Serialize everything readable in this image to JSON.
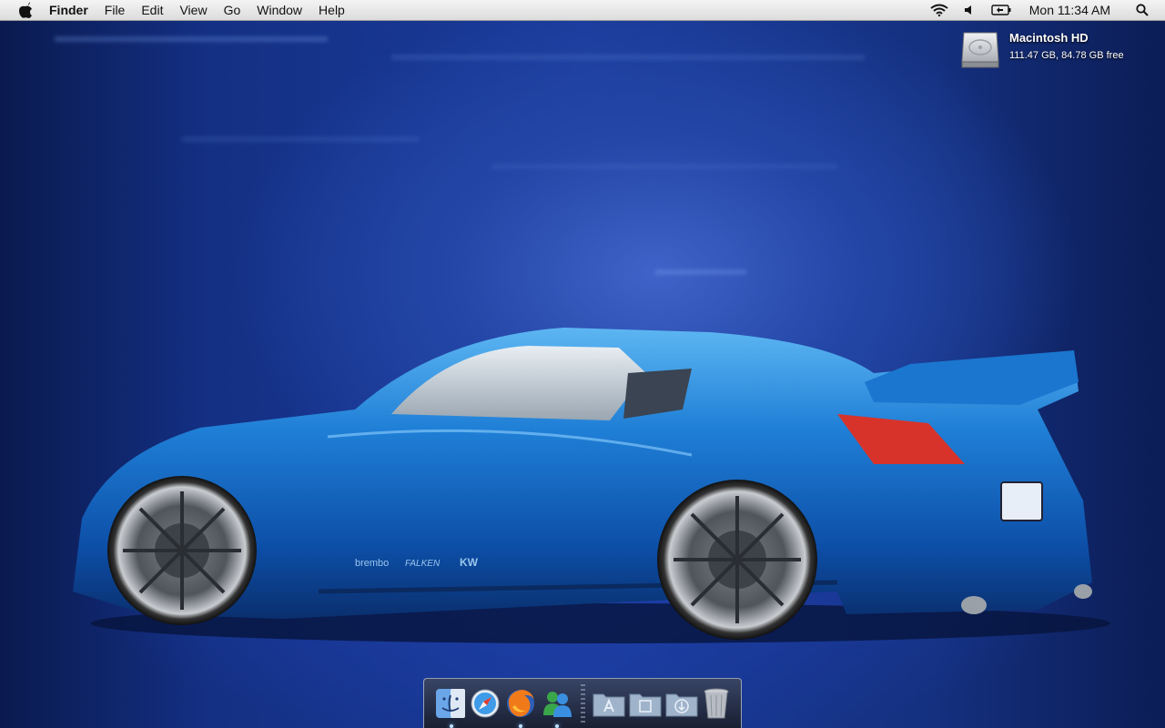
{
  "menubar": {
    "apple_icon": "apple-icon",
    "app_name": "Finder",
    "items": [
      "File",
      "Edit",
      "View",
      "Go",
      "Window",
      "Help"
    ],
    "status_icons": [
      "wifi-icon",
      "volume-icon",
      "battery-icon"
    ],
    "clock": "Mon 11:34 AM",
    "search_icon": "spotlight-search-icon"
  },
  "desktop": {
    "drive": {
      "name": "Macintosh HD",
      "info": "111.47 GB, 84.78 GB free",
      "icon": "hard-drive-icon"
    },
    "car_decals": [
      "brembo",
      "FALKEN",
      "KW"
    ]
  },
  "dock": {
    "apps": [
      {
        "name": "Finder",
        "icon": "finder-icon",
        "running": true
      },
      {
        "name": "Safari",
        "icon": "safari-icon",
        "running": false
      },
      {
        "name": "Firefox",
        "icon": "firefox-icon",
        "running": true
      },
      {
        "name": "Messenger",
        "icon": "messenger-icon",
        "running": true
      }
    ],
    "stacks": [
      {
        "name": "Applications",
        "icon": "applications-folder-icon"
      },
      {
        "name": "Documents",
        "icon": "documents-folder-icon"
      },
      {
        "name": "Downloads",
        "icon": "downloads-folder-icon"
      }
    ],
    "trash": {
      "name": "Trash",
      "icon": "trash-icon"
    }
  }
}
